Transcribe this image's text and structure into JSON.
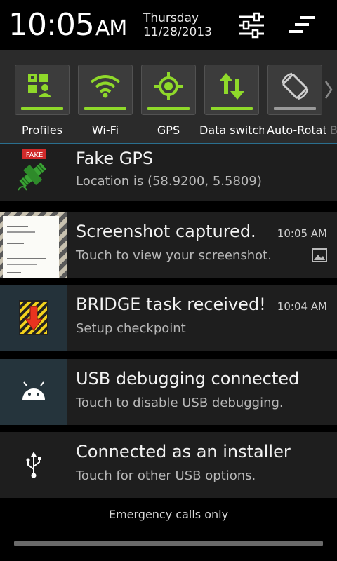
{
  "header": {
    "time": "10:05",
    "ampm": "AM",
    "day": "Thursday",
    "date": "11/28/2013",
    "settings_icon": "sliders-icon",
    "clear_icon": "clear-all-icon"
  },
  "toggles": [
    {
      "label": "Profiles",
      "icon": "profiles-icon",
      "state": "on"
    },
    {
      "label": "Wi-Fi",
      "icon": "wifi-icon",
      "state": "on"
    },
    {
      "label": "GPS",
      "icon": "gps-icon",
      "state": "on"
    },
    {
      "label": "Data switch",
      "icon": "data-switch-icon",
      "state": "on"
    },
    {
      "label": "Auto-Rotate",
      "icon": "auto-rotate-icon",
      "state": "off"
    }
  ],
  "toggles_more": "B",
  "notifications": [
    {
      "title": "Fake GPS",
      "text": "Location is (58.9200, 5.5809)",
      "time": "",
      "icon": "fake-gps-icon"
    },
    {
      "title": "Screenshot captured.",
      "text": "Touch to view your screenshot.",
      "time": "10:05 AM",
      "icon": "screenshot-thumbnail"
    },
    {
      "title": "BRIDGE task received!",
      "text": "Setup checkpoint",
      "time": "10:04 AM",
      "icon": "bridge-task-icon"
    },
    {
      "title": "USB debugging connected",
      "text": "Touch to disable USB debugging.",
      "time": "",
      "icon": "android-icon"
    },
    {
      "title": "Connected as an installer",
      "text": "Touch for other USB options.",
      "time": "",
      "icon": "usb-icon"
    }
  ],
  "emergency": "Emergency calls only",
  "colors": {
    "accent_green": "#8fd92a",
    "divider_blue": "#2a6f8f"
  }
}
